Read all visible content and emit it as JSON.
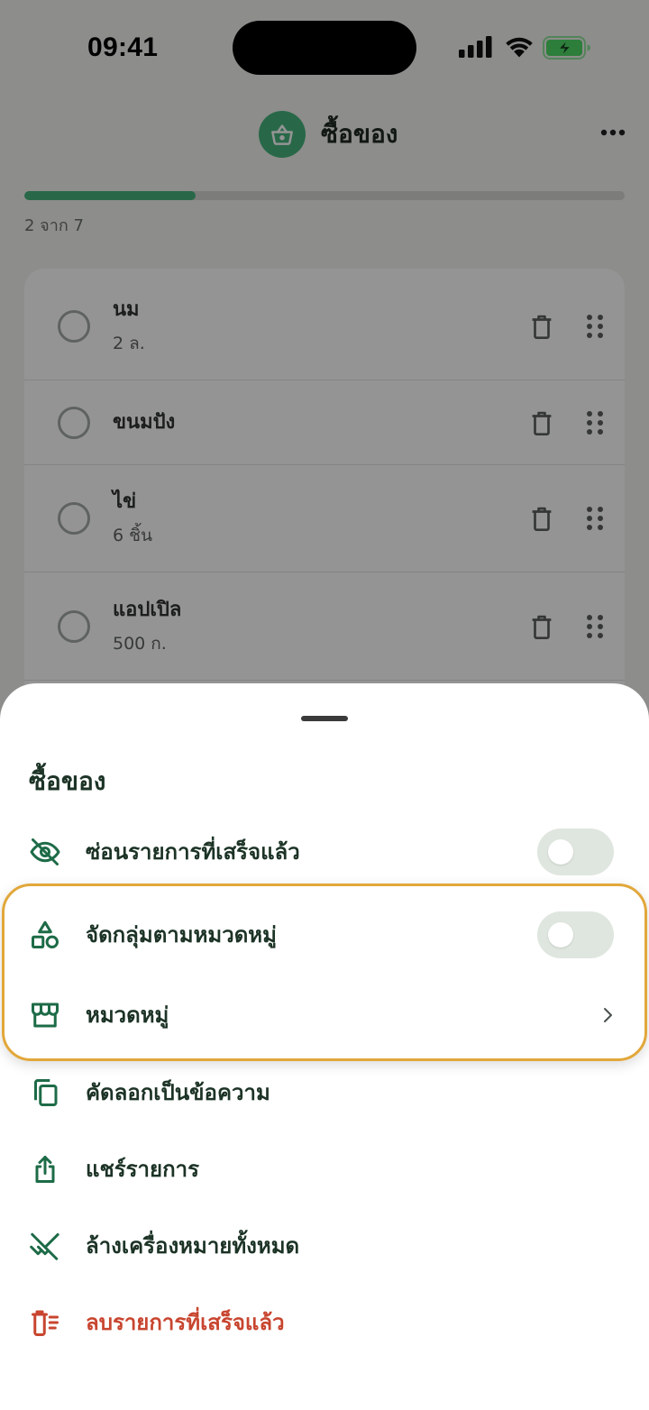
{
  "status_bar": {
    "time": "09:41",
    "battery_charging": true
  },
  "header": {
    "title": "ซื้อของ",
    "icon": "basket-icon",
    "menu_icon": "more-horizontal-icon"
  },
  "progress": {
    "completed": 2,
    "total": 7,
    "label": "2 จาก 7"
  },
  "list": {
    "items": [
      {
        "name": "นม",
        "quantity": "2 ล.",
        "checked": false
      },
      {
        "name": "ขนมปัง",
        "checked": false
      },
      {
        "name": "ไข่",
        "quantity": "6 ชิ้น",
        "checked": false
      },
      {
        "name": "แอปเปิล",
        "quantity": "500 ก.",
        "checked": false
      }
    ]
  },
  "sheet": {
    "title": "ซื้อของ",
    "options": [
      {
        "label": "ซ่อนรายการที่เสร็จแล้ว",
        "icon": "eye-off-icon",
        "on": false
      },
      {
        "label": "จัดกลุ่มตามหมวดหมู่",
        "icon": "shapes-icon",
        "on": false,
        "highlighted": true
      },
      {
        "label": "หมวดหมู่",
        "icon": "storefront-icon",
        "highlighted": true
      },
      {
        "label": "คัดลอกเป็นข้อความ",
        "icon": "copy-icon"
      },
      {
        "label": "แชร์รายการ",
        "icon": "share-icon"
      },
      {
        "label": "ล้างเครื่องหมายทั้งหมด",
        "icon": "remove-done-icon"
      },
      {
        "label": "ลบรายการที่เสร็จแล้ว",
        "icon": "delete-sweep-icon",
        "destructive": true
      }
    ]
  },
  "colors": {
    "primary": "#45b37c",
    "icon": "#1d6b47",
    "text": "#1c3326",
    "destructive": "#c8452f",
    "toggle_track": "#dfe6df",
    "highlight": "#e2a73a"
  }
}
